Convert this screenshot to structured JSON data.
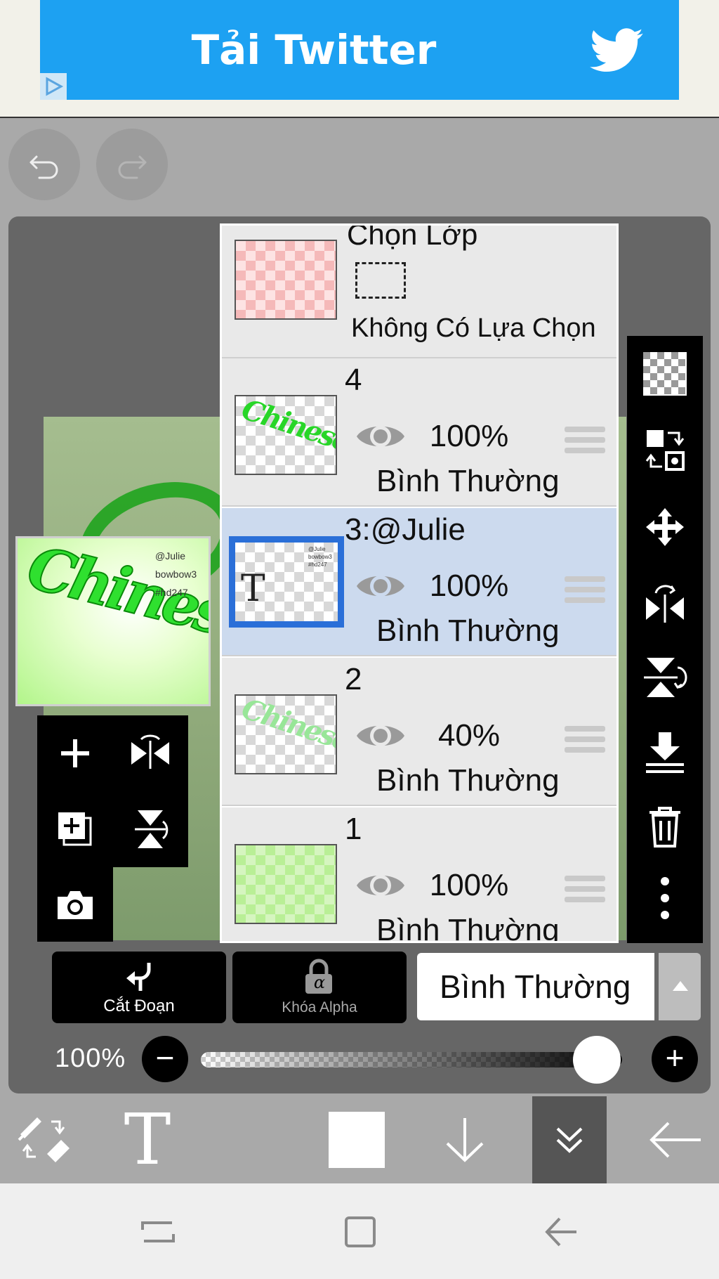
{
  "ad": {
    "title": "Tải Twitter",
    "brand_color": "#1da1f2"
  },
  "icons": {
    "undo": "undo-arrow-icon",
    "redo": "redo-arrow-icon",
    "twitter": "twitter-bird-icon",
    "eye": "eye-icon",
    "handle": "drag-handle-icon"
  },
  "preview": {
    "word": "Chinese",
    "tags": [
      "@Julie",
      "bowbow3",
      "#hd247"
    ]
  },
  "layers": {
    "selection_layer": {
      "title": "Chọn Lớp",
      "status": "Không Có Lựa Chọn"
    },
    "items": [
      {
        "name": "4",
        "opacity": "100%",
        "blend": "Bình Thường",
        "thumb_word": "Chinese"
      },
      {
        "name": "3:@Julie",
        "opacity": "100%",
        "blend": "Bình Thường",
        "thumb_letter": "T",
        "thumb_mini": "@Julie bowbow3 #hd247",
        "selected": true
      },
      {
        "name": "2",
        "opacity": "40%",
        "blend": "Bình Thường",
        "thumb_word": "Chinese"
      },
      {
        "name": "1",
        "opacity": "100%",
        "blend": "Bình Thường"
      }
    ]
  },
  "layer_options": {
    "clip_label": "Cắt Đoạn",
    "alpha_lock_label": "Khóa Alpha",
    "alpha_symbol": "α",
    "blend_mode": "Bình Thường"
  },
  "opacity_slider": {
    "value_label": "100%",
    "value": 1.0,
    "minus": "−",
    "plus": "+"
  },
  "bottom_toolbar": {
    "text_tool": "T",
    "color": "#ffffff"
  },
  "accent_color": "#2a6fd8",
  "selected_row_color": "#ccdaee"
}
